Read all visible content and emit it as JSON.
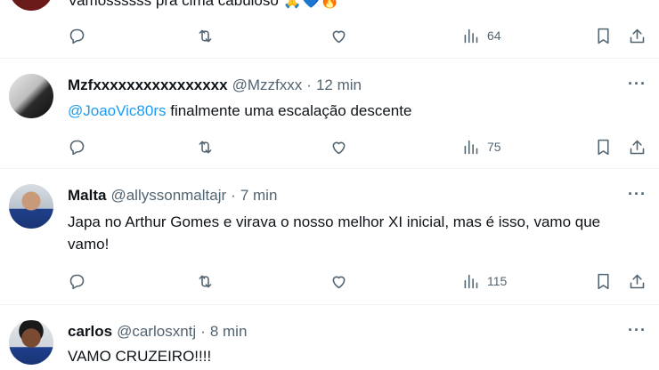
{
  "posts": [
    {
      "text": "Vamossssss pra cima cabuloso 🙏💙🔥",
      "views": "64"
    },
    {
      "name": "Mzfxxxxxxxxxxxxxxxx",
      "handle": "@Mzzfxxx",
      "separator": "·",
      "time": "12 min",
      "mention": "@JoaoVic80rs",
      "text": " finalmente uma escalação descente",
      "views": "75"
    },
    {
      "name": "Malta",
      "handle": "@allyssonmaltajr",
      "separator": "·",
      "time": "7 min",
      "text": "Japa no Arthur Gomes e virava o nosso melhor XI inicial, mas é isso, vamo que vamo!",
      "views": "115"
    },
    {
      "name": "carlos",
      "handle": "@carlosxntj",
      "separator": "·",
      "time": "8 min",
      "text": "VAMO CRUZEIRO!!!!"
    }
  ],
  "more_label": "···",
  "icons": {
    "reply": "reply-icon",
    "repost": "repost-icon",
    "like": "like-icon",
    "views": "views-icon",
    "bookmark": "bookmark-icon",
    "share": "share-icon"
  }
}
